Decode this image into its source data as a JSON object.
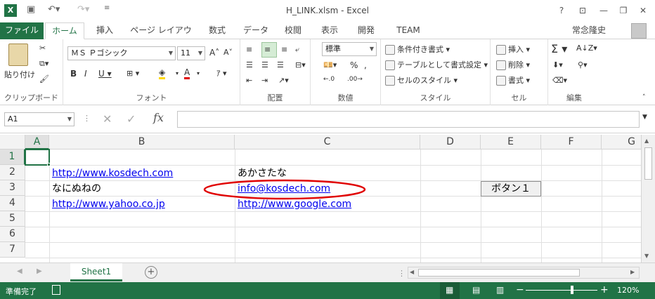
{
  "window": {
    "title": "H_LINK.xlsm - Excel",
    "user": "常念隆史"
  },
  "ribbon_tabs": [
    "ファイル",
    "ホーム",
    "挿入",
    "ページ レイアウト",
    "数式",
    "データ",
    "校閲",
    "表示",
    "開発",
    "TEAM"
  ],
  "clipboard": {
    "paste": "貼り付け",
    "label": "クリップボード"
  },
  "font": {
    "name": "ＭＳ Ｐゴシック",
    "size": "11",
    "label": "フォント"
  },
  "alignment": {
    "label": "配置"
  },
  "number": {
    "format": "標準",
    "label": "数値"
  },
  "styles": {
    "conditional": "条件付き書式",
    "table": "テーブルとして書式設定",
    "cell": "セルのスタイル",
    "label": "スタイル"
  },
  "cells": {
    "insert": "挿入",
    "delete": "削除",
    "format": "書式",
    "label": "セル"
  },
  "editing": {
    "label": "編集"
  },
  "formula_bar": {
    "name_box": "A1",
    "fx": "fx",
    "value": ""
  },
  "columns": [
    "A",
    "B",
    "C",
    "D",
    "E",
    "F",
    "G"
  ],
  "rows": [
    "1",
    "2",
    "3",
    "4",
    "5",
    "6",
    "7"
  ],
  "sheet": {
    "b2": "http://www.kosdech.com",
    "c2": "あかさたな",
    "b3": "なにぬねの",
    "c3": "info@kosdech.com",
    "e3_button": "ボタン１",
    "b4": "http://www.yahoo.co.jp",
    "c4": "http://www.google.com"
  },
  "sheet_tabs": [
    "Sheet1"
  ],
  "status": {
    "ready": "準備完了",
    "zoom": "120%"
  },
  "colors": {
    "excel_green": "#217346",
    "highlight_ellipse": "#e00000",
    "link": "#0000ee"
  }
}
